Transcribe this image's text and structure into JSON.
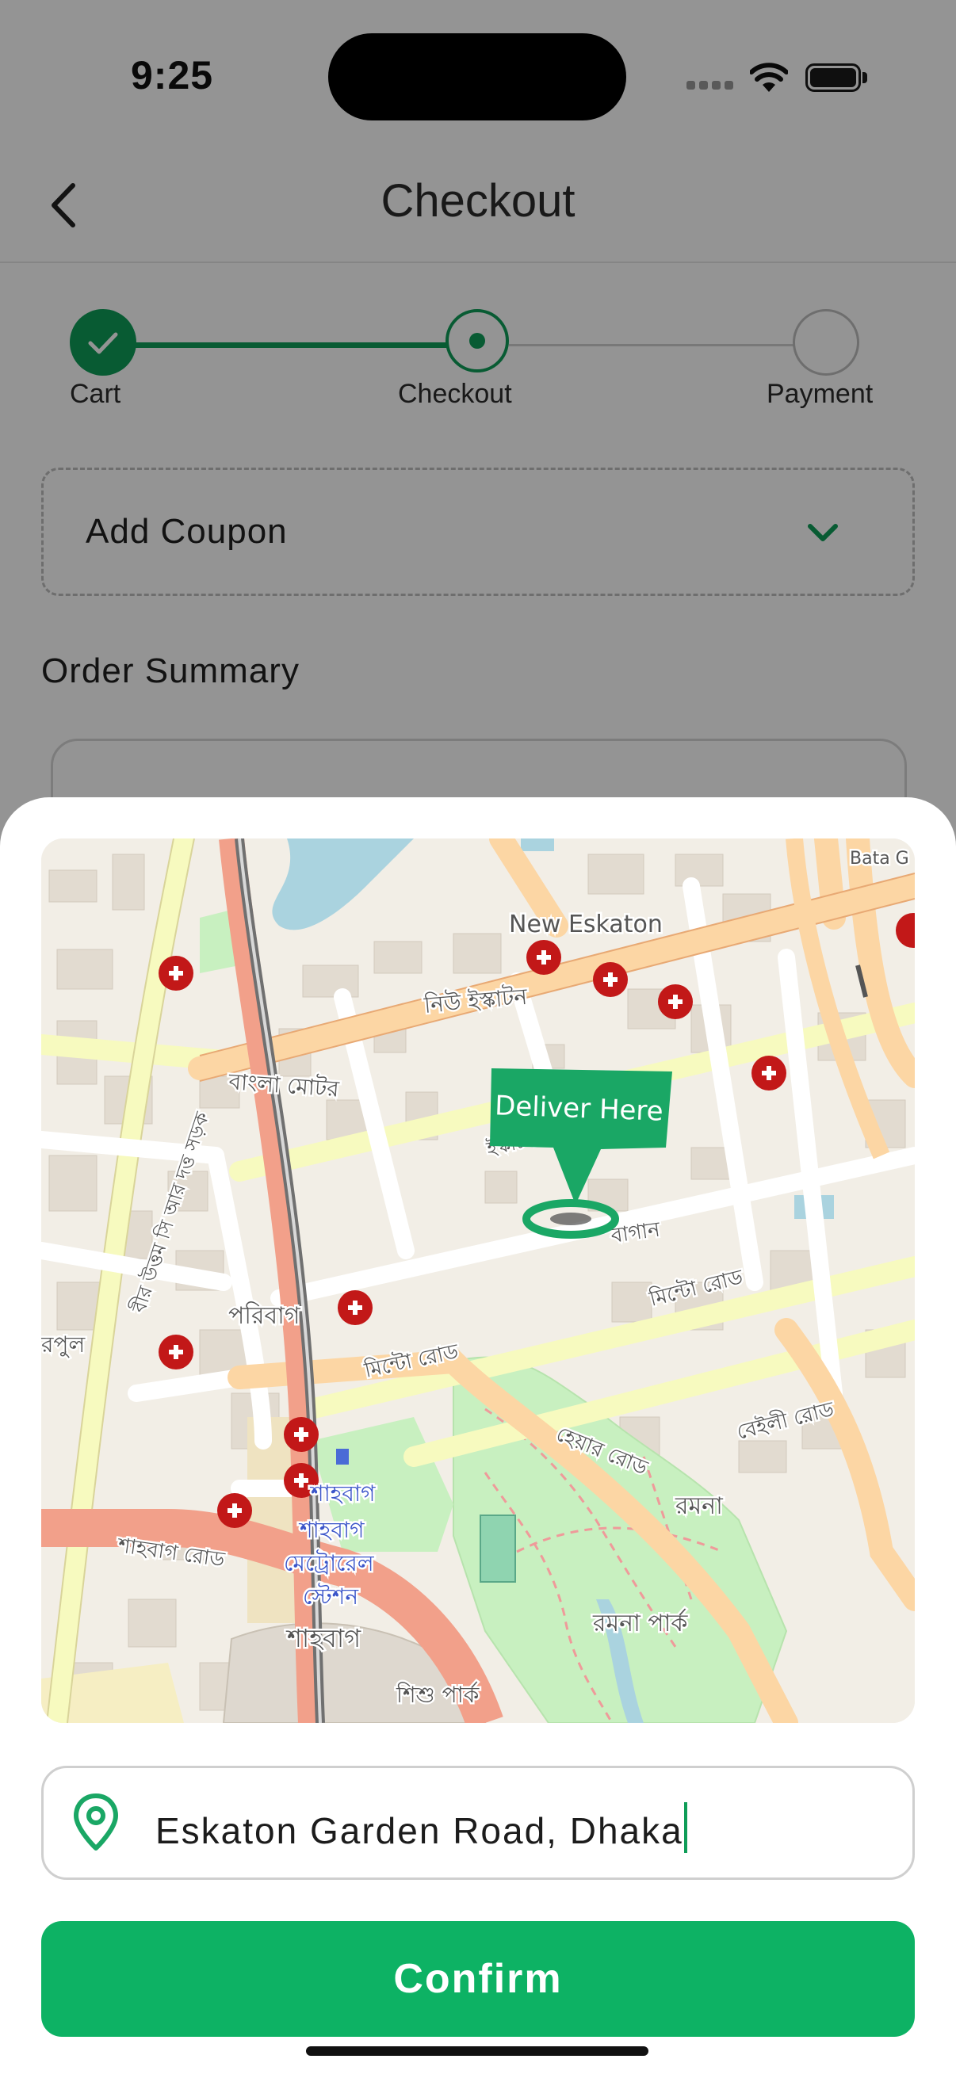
{
  "status_bar": {
    "time": "9:25"
  },
  "header": {
    "title": "Checkout"
  },
  "stepper": {
    "steps": [
      {
        "label": "Cart",
        "state": "done"
      },
      {
        "label": "Checkout",
        "state": "current"
      },
      {
        "label": "Payment",
        "state": "pending"
      }
    ]
  },
  "coupon": {
    "label": "Add Coupon"
  },
  "order_summary": {
    "title": "Order Summary"
  },
  "map": {
    "marker_label": "Deliver Here",
    "labels": {
      "new_eskaton": "New Eskaton",
      "new_eskaton_bn": "নিউ ইস্কাটন",
      "bangla_motor": "বাংলা মোটর",
      "paribag": "পরিবাগ",
      "minto_road": "মিন্টো রোড",
      "minto_road_2": "মিন্টো রোড",
      "eskaton_garden": "ইস্কাটন গার্ডেন",
      "bagan": "বাগান",
      "hare_road": "হেয়ার রোড",
      "baily_road": "বেইলী রোড",
      "ramna": "রমনা",
      "ramna_park": "রমনা পার্ক",
      "shahbag_road": "শাহবাগ রোড",
      "shahbag": "শাহবাগ",
      "shahbag_metro_1": "শাহবাগ",
      "shahbag_metro_2": "শাহবাগ",
      "shahbag_metro_3": "মেট্রোরেল",
      "shahbag_metro_4": "স্টেশন",
      "shishu_park": "শিশু পার্ক",
      "bata": "Bata G",
      "road_vertical": "বীর উত্তম সি আর দত্ত সড়ক",
      "rapul": "রপুল"
    }
  },
  "address": {
    "value": "Eskaton Garden Road, Dhaka"
  },
  "confirm": {
    "label": "Confirm"
  },
  "colors": {
    "primary": "#0f9d58",
    "button": "#0db264",
    "marker": "#1aa765",
    "hospital": "#c21818"
  }
}
